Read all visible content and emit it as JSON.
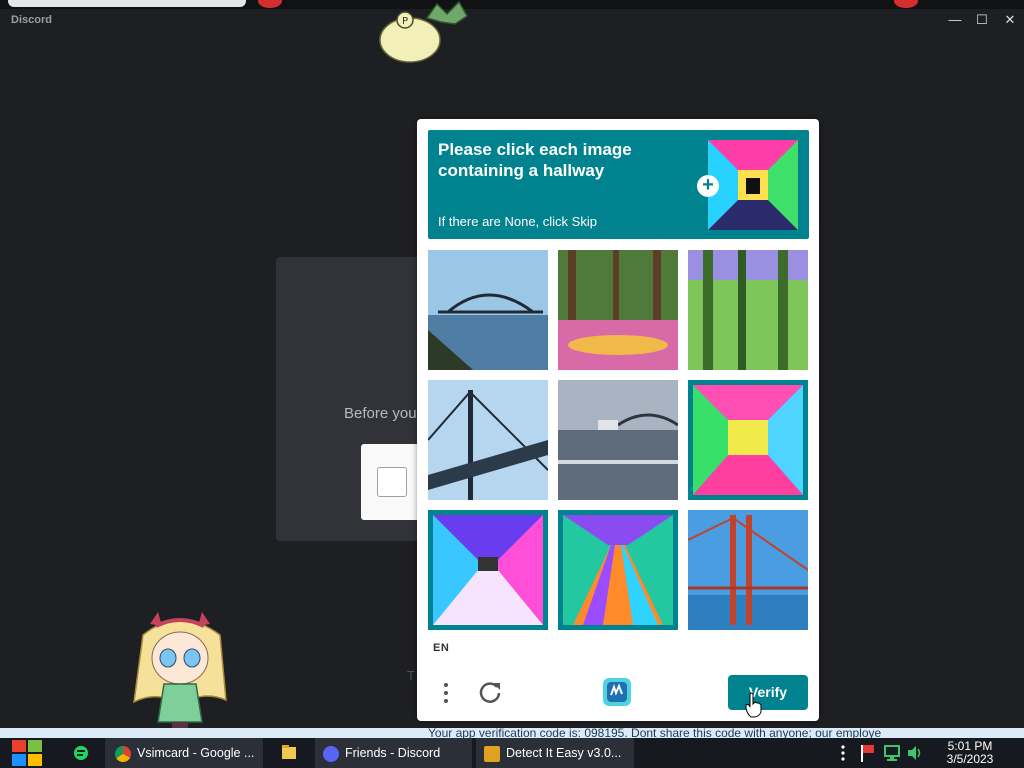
{
  "window": {
    "app_title": "Discord",
    "minimize": "—",
    "maximize": "☐",
    "close": "✕"
  },
  "background": {
    "before_text": "Before you",
    "obscured_text": "T"
  },
  "captcha": {
    "prompt_title": "Please click each image containing a hallway",
    "prompt_sub": "If there are None, click Skip",
    "prompt_example": "hallway-example",
    "tiles": [
      {
        "subject": "bridge-over-river",
        "selected": false
      },
      {
        "subject": "forest-flowers",
        "selected": false
      },
      {
        "subject": "forest-trees",
        "selected": false
      },
      {
        "subject": "suspension-bridge",
        "selected": false
      },
      {
        "subject": "harbour-bridge",
        "selected": false
      },
      {
        "subject": "neon-hallway",
        "selected": true
      },
      {
        "subject": "neon-hallway",
        "selected": true
      },
      {
        "subject": "neon-hallway",
        "selected": true
      },
      {
        "subject": "golden-gate-bridge",
        "selected": false
      }
    ],
    "language": "EN",
    "verify_label": "Verify",
    "accent": "#00838f"
  },
  "notification": {
    "text": "Your app verification code is: 098195. Dont share this code with anyone; our employe"
  },
  "taskbar": {
    "items": [
      {
        "label": "Vsimcard - Google ...",
        "icon": "chrome-icon"
      },
      {
        "label": "Friends - Discord",
        "icon": "discord-icon"
      },
      {
        "label": "Detect It Easy v3.0...",
        "icon": "die-icon"
      }
    ],
    "time": "5:01 PM",
    "date": "3/5/2023"
  }
}
